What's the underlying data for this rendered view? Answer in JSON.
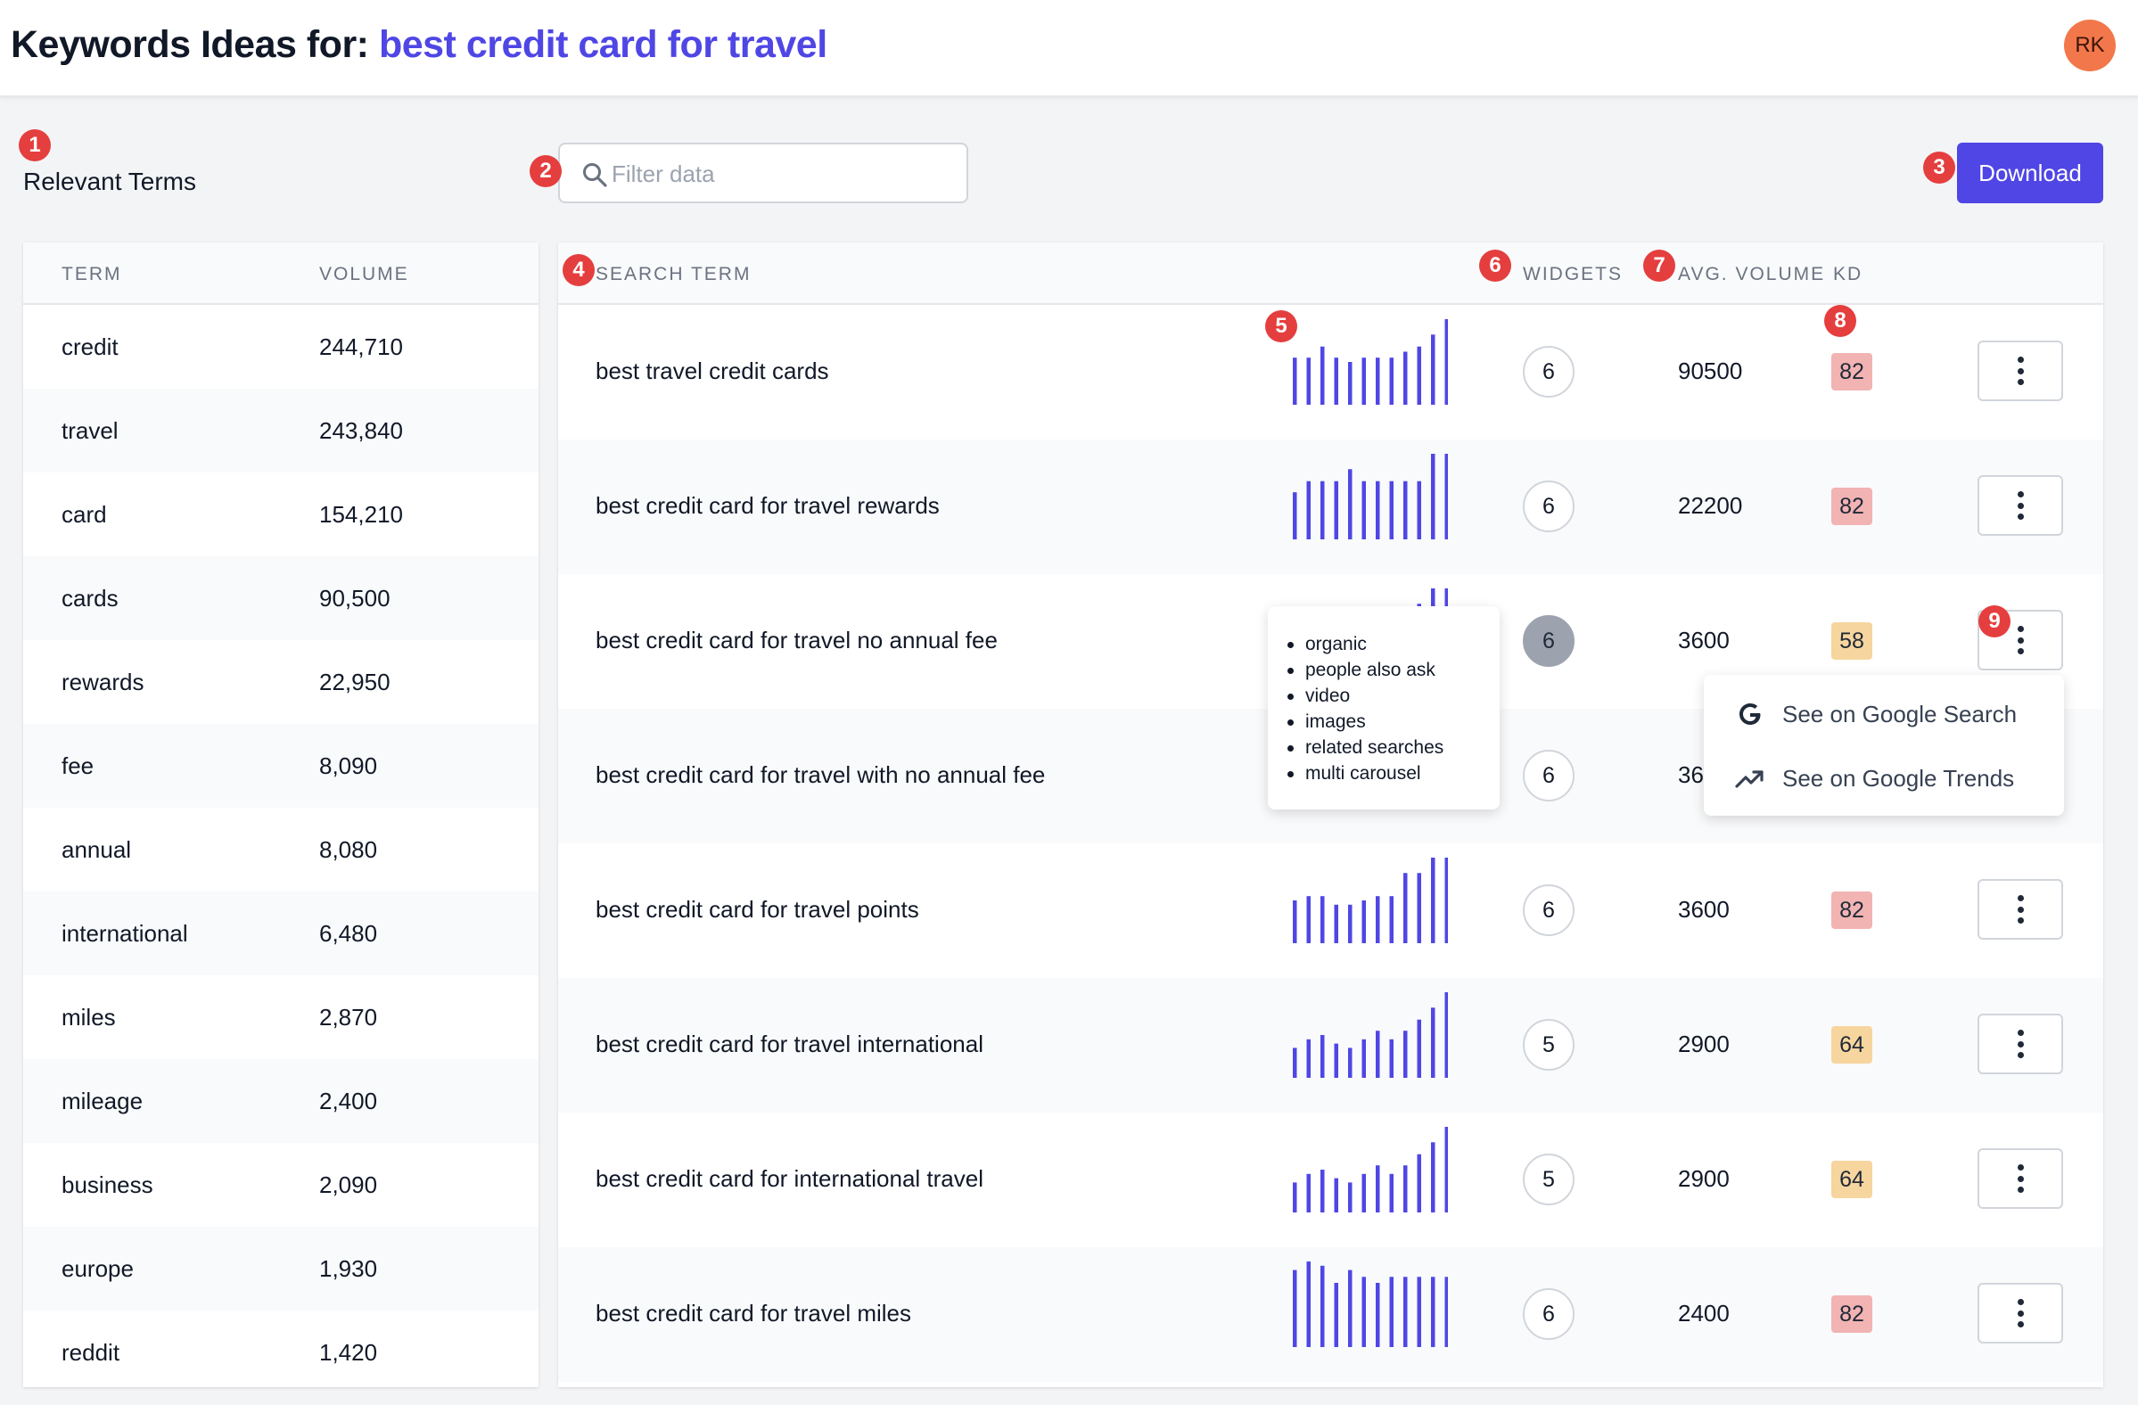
{
  "header": {
    "title_prefix": "Keywords Ideas for:",
    "query": "best credit card for travel",
    "avatar_initials": "RK"
  },
  "markers": [
    "1",
    "2",
    "3",
    "4",
    "5",
    "6",
    "7",
    "8",
    "9"
  ],
  "relevant_terms": {
    "label": "Relevant Terms",
    "columns": [
      "TERM",
      "VOLUME"
    ],
    "rows": [
      {
        "term": "credit",
        "volume": "244,710"
      },
      {
        "term": "travel",
        "volume": "243,840"
      },
      {
        "term": "card",
        "volume": "154,210"
      },
      {
        "term": "cards",
        "volume": "90,500"
      },
      {
        "term": "rewards",
        "volume": "22,950"
      },
      {
        "term": "fee",
        "volume": "8,090"
      },
      {
        "term": "annual",
        "volume": "8,080"
      },
      {
        "term": "international",
        "volume": "6,480"
      },
      {
        "term": "miles",
        "volume": "2,870"
      },
      {
        "term": "mileage",
        "volume": "2,400"
      },
      {
        "term": "business",
        "volume": "2,090"
      },
      {
        "term": "europe",
        "volume": "1,930"
      },
      {
        "term": "reddit",
        "volume": "1,420"
      }
    ]
  },
  "filter": {
    "placeholder": "Filter data",
    "value": ""
  },
  "download_label": "Download",
  "results": {
    "columns": {
      "search_term": "SEARCH TERM",
      "widgets": "WIDGETS",
      "avg_volume": "AVG. VOLUME",
      "kd": "KD"
    },
    "accent_color": "#4f46e5",
    "rows": [
      {
        "term": "best travel credit cards",
        "widgets": "6",
        "avg_volume": "90500",
        "kd": "82",
        "kd_level": "red",
        "trend": [
          0.55,
          0.55,
          0.68,
          0.55,
          0.5,
          0.55,
          0.55,
          0.55,
          0.62,
          0.68,
          0.82,
          1.0
        ]
      },
      {
        "term": "best credit card for travel rewards",
        "widgets": "6",
        "avg_volume": "22200",
        "kd": "82",
        "kd_level": "red",
        "trend": [
          0.55,
          0.68,
          0.68,
          0.68,
          0.82,
          0.68,
          0.68,
          0.68,
          0.68,
          0.68,
          1.0,
          1.0
        ]
      },
      {
        "term": "best credit card for travel no annual fee",
        "widgets": "6",
        "avg_volume": "3600",
        "kd": "58",
        "kd_level": "yellow",
        "trend": [
          0.5,
          0.5,
          0.5,
          0.5,
          0.5,
          0.5,
          0.55,
          0.5,
          0.5,
          0.82,
          1.0,
          1.0
        ],
        "widgets_active": true
      },
      {
        "term": "best credit card for travel with no annual fee",
        "widgets": "6",
        "avg_volume": "3600",
        "kd": "",
        "kd_level": "red",
        "trend": []
      },
      {
        "term": "best credit card for travel points",
        "widgets": "6",
        "avg_volume": "3600",
        "kd": "82",
        "kd_level": "red",
        "trend": [
          0.5,
          0.55,
          0.55,
          0.45,
          0.45,
          0.5,
          0.55,
          0.55,
          0.82,
          0.82,
          1.0,
          1.0
        ]
      },
      {
        "term": "best credit card for travel international",
        "widgets": "5",
        "avg_volume": "2900",
        "kd": "64",
        "kd_level": "yellow",
        "trend": [
          0.35,
          0.45,
          0.5,
          0.4,
          0.35,
          0.45,
          0.55,
          0.45,
          0.55,
          0.68,
          0.82,
          1.0
        ]
      },
      {
        "term": "best credit card for international travel",
        "widgets": "5",
        "avg_volume": "2900",
        "kd": "64",
        "kd_level": "yellow",
        "trend": [
          0.35,
          0.45,
          0.5,
          0.4,
          0.35,
          0.45,
          0.55,
          0.45,
          0.55,
          0.68,
          0.82,
          1.0
        ]
      },
      {
        "term": "best credit card for travel miles",
        "widgets": "6",
        "avg_volume": "2400",
        "kd": "82",
        "kd_level": "red",
        "trend": [
          0.9,
          1.0,
          0.95,
          0.75,
          0.9,
          0.82,
          0.75,
          0.82,
          0.82,
          0.82,
          0.82,
          0.82
        ]
      }
    ]
  },
  "widgets_tooltip": {
    "items": [
      "organic",
      "people also ask",
      "video",
      "images",
      "related searches",
      "multi carousel"
    ]
  },
  "row_menu": {
    "items": [
      {
        "label": "See on Google Search",
        "icon": "google-icon"
      },
      {
        "label": "See on Google Trends",
        "icon": "trending-up-icon"
      }
    ]
  }
}
